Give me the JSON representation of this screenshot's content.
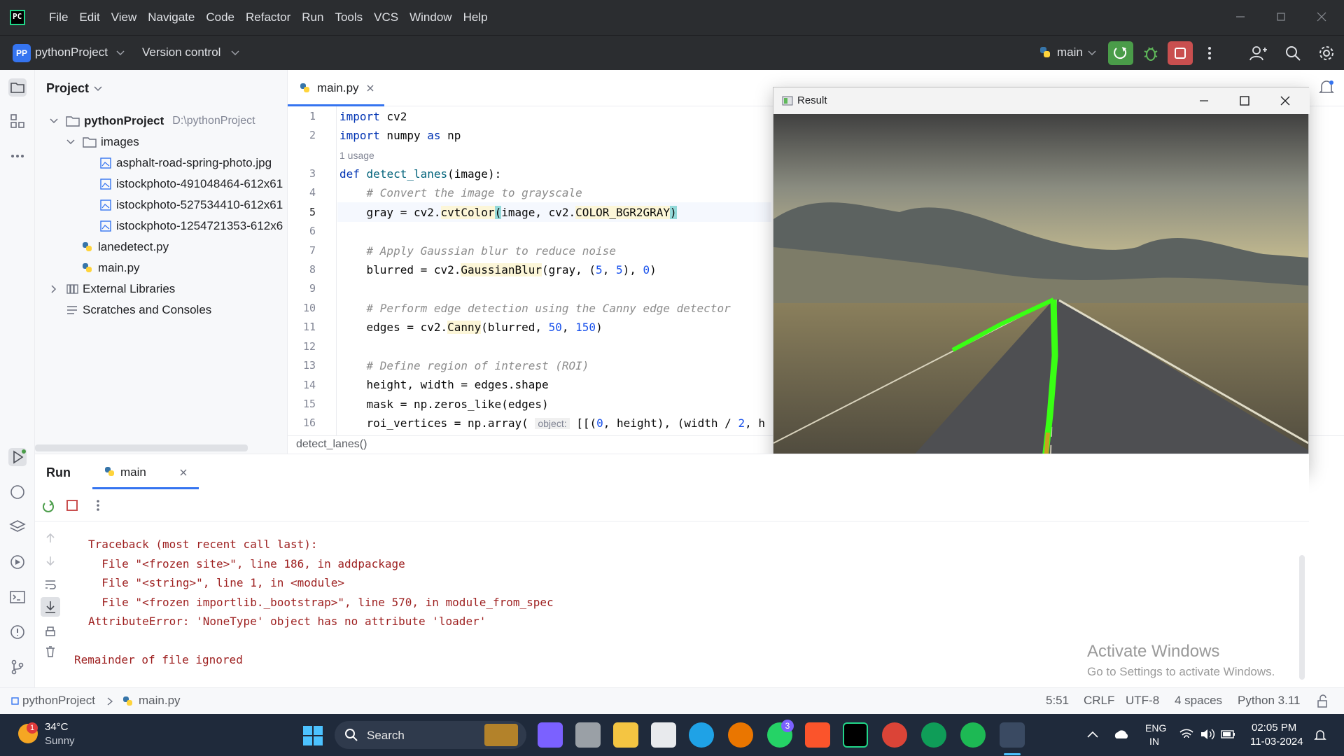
{
  "menu": [
    "File",
    "Edit",
    "View",
    "Navigate",
    "Code",
    "Refactor",
    "Run",
    "Tools",
    "VCS",
    "Window",
    "Help"
  ],
  "toolbar": {
    "project_badge": "PP",
    "project_name": "pythonProject",
    "vcs": "Version control",
    "run_config": "main"
  },
  "project_panel": {
    "title": "Project",
    "root": "pythonProject",
    "root_path": "D:\\pythonProject",
    "folder": "images",
    "files": [
      "asphalt-road-spring-photo.jpg",
      "istockphoto-491048464-612x61",
      "istockphoto-527534410-612x61",
      "istockphoto-1254721353-612x6"
    ],
    "scripts": [
      "lanedetect.py",
      "main.py"
    ],
    "external": "External Libraries",
    "scratches": "Scratches and Consoles"
  },
  "editor": {
    "tab": "main.py",
    "usage_hint": "1 usage",
    "param_hint": "object:",
    "breadcrumb": "detect_lanes()",
    "line_numbers": [
      "1",
      "2",
      "3",
      "4",
      "5",
      "6",
      "7",
      "8",
      "9",
      "10",
      "11",
      "12",
      "13",
      "14",
      "15",
      "16"
    ]
  },
  "result_window": {
    "title": "Result"
  },
  "run_panel": {
    "title": "Run",
    "tab": "main",
    "output": [
      "Traceback (most recent call last):",
      "  File \"<frozen site>\", line 186, in addpackage",
      "  File \"<string>\", line 1, in <module>",
      "  File \"<frozen importlib._bootstrap>\", line 570, in module_from_spec",
      "AttributeError: 'NoneType' object has no attribute 'loader'"
    ],
    "remainder": "Remainder of file ignored",
    "watermark_title": "Activate Windows",
    "watermark_sub": "Go to Settings to activate Windows."
  },
  "statusbar": {
    "project": "pythonProject",
    "file": "main.py",
    "position": "5:51",
    "line_sep": "CRLF",
    "encoding": "UTF-8",
    "indent": "4 spaces",
    "interpreter": "Python 3.11"
  },
  "taskbar": {
    "weather_temp": "34°C",
    "weather_desc": "Sunny",
    "weather_badge": "1",
    "search": "Search",
    "whatsapp_badge": "3",
    "lang1": "ENG",
    "lang2": "IN",
    "time": "02:05 PM",
    "date": "11-03-2024"
  },
  "colors": {
    "accent": "#3574f0",
    "run_green": "#4a9c49",
    "stop_red": "#c94f4f",
    "error_text": "#9d1f1f",
    "lane_green": "#39ff14"
  }
}
